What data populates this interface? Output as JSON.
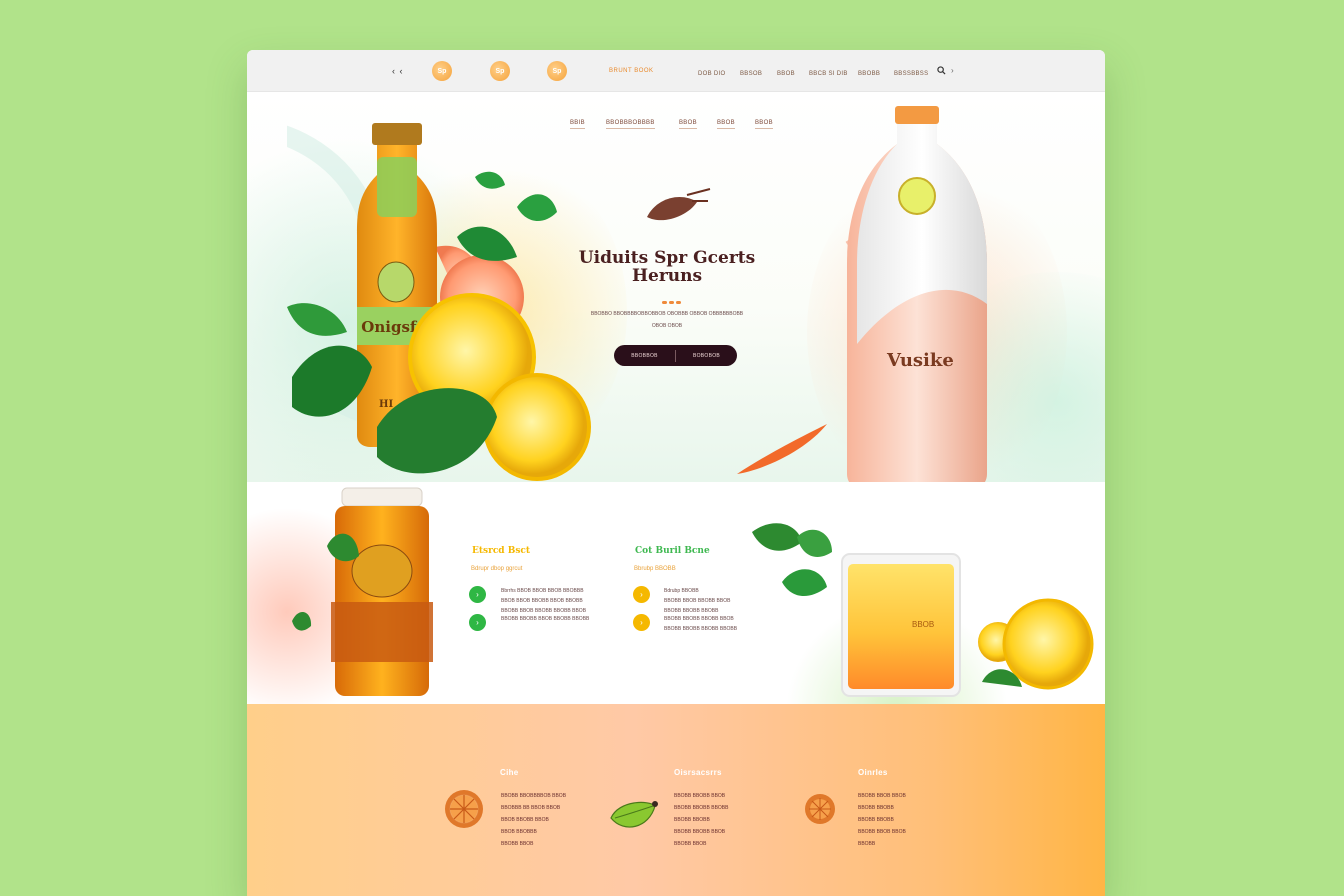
{
  "colors": {
    "page_bg": "#b1e38a",
    "accent_orange": "#ef8a3a",
    "accent_green": "#2fb744",
    "accent_yellow": "#f5b800",
    "cta_dark": "#2a0f1a",
    "title_brown": "#4a2020"
  },
  "topbar": {
    "back_label": "‹ ‹",
    "logos": [
      "Sp",
      "Sp",
      "Sp"
    ],
    "brand": "BRUNT BOOK",
    "nav": [
      "DOB DIO",
      "BBSOB",
      "BBOB",
      "BBCB SI DIB",
      "BBOBB",
      "BBSSBBSS"
    ],
    "search_icon": "search-icon",
    "chevron": "›"
  },
  "hero": {
    "nav": [
      "BBIB",
      "BBOBBBOBBBB",
      "BBOB",
      "BBOB",
      "BBOB"
    ],
    "title_line1": "Uiduits Spr Gcerts",
    "title_line2": "Heruns",
    "subtitle_line1": "BBOBBO BBOBBBBOBBOBBOB   OBOBBB OBBOB   OBBBBBBOBB",
    "subtitle_line2": "OBOB OBOB",
    "cta_left": "BBOBBOB",
    "cta_right": "BOBOBOB",
    "left_bottle_label": "Onigsfrs",
    "left_bottle_sub": "HI",
    "right_bottle_label": "Vusike"
  },
  "features": {
    "left": {
      "title": "Etsrcd Bsct",
      "subtitle": "Bdrupr dbop ggrcut",
      "items": [
        {
          "icon": "check-icon",
          "lines": [
            "Bbrrhs BBOB BBOB BBOB BBOBBB",
            "BBOB BBOB BBOBB BBOB BBOBB",
            "BBOBB BBOB BBOBB BBOBB BBOB"
          ]
        },
        {
          "icon": "check-icon",
          "lines": [
            "BBOBB BBOBB BBOB BBOBB BBOBB"
          ]
        }
      ]
    },
    "right": {
      "title": "Cot Buril Bcne",
      "subtitle": "Bbrubp BBOBB",
      "items": [
        {
          "icon": "arrow-icon",
          "lines": [
            "Bdrubp BBOBB",
            "BBOBB BBOB BBOBB BBOB",
            "BBOBB BBOBB BBOBB"
          ]
        },
        {
          "icon": "arrow-icon",
          "lines": [
            "BBOBB BBOBB BBOBB BBOB",
            "BBOBB BBOBB BBOBB BBOBB"
          ]
        }
      ],
      "jar_label": "BBOB"
    }
  },
  "bottom": {
    "columns": [
      {
        "title": "Cihe",
        "icon": "orange-slice-icon",
        "lines": [
          "BBOBB BBOBBBBOB BBOB",
          "BBOBBB BB BBOB BBOB",
          "BBOB BBOBB BBOB",
          "BBOB BBOBBB",
          "BBOBB BBOB"
        ]
      },
      {
        "title": "Oisrsacsrrs",
        "icon": "leaf-icon",
        "lines": [
          "BBOBB BBOBB BBOB",
          "BBOBB BBOBB BBOBB",
          "BBOBB BBOBB",
          "BBOBB BBOBB BBOB",
          "BBOBB BBOB"
        ]
      },
      {
        "title": "Oinrles",
        "icon": "orange-slice-icon",
        "lines": [
          "BBOBB BBOB BBOB",
          "BBOBB BBOBB",
          "BBOBB BBOBB",
          "BBOBB BBOB BBOB",
          "BBOBB"
        ]
      }
    ]
  }
}
